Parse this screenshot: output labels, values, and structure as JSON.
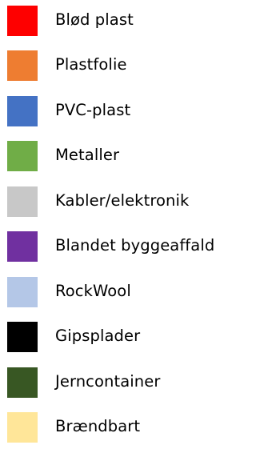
{
  "legend": {
    "items": [
      {
        "label": "Blød plast",
        "color": "#fe0000"
      },
      {
        "label": "Plastfolie",
        "color": "#ee7d31"
      },
      {
        "label": "PVC-plast",
        "color": "#4472c4"
      },
      {
        "label": "Metaller",
        "color": "#70ad47"
      },
      {
        "label": "Kabler/elektronik",
        "color": "#c8c8c8"
      },
      {
        "label": "Blandet byggeaffald",
        "color": "#7030a0"
      },
      {
        "label": "RockWool",
        "color": "#b4c7e7"
      },
      {
        "label": "Gipsplader",
        "color": "#000000"
      },
      {
        "label": "Jerncontainer",
        "color": "#385723"
      },
      {
        "label": "Brændbart",
        "color": "#ffe699"
      }
    ]
  }
}
